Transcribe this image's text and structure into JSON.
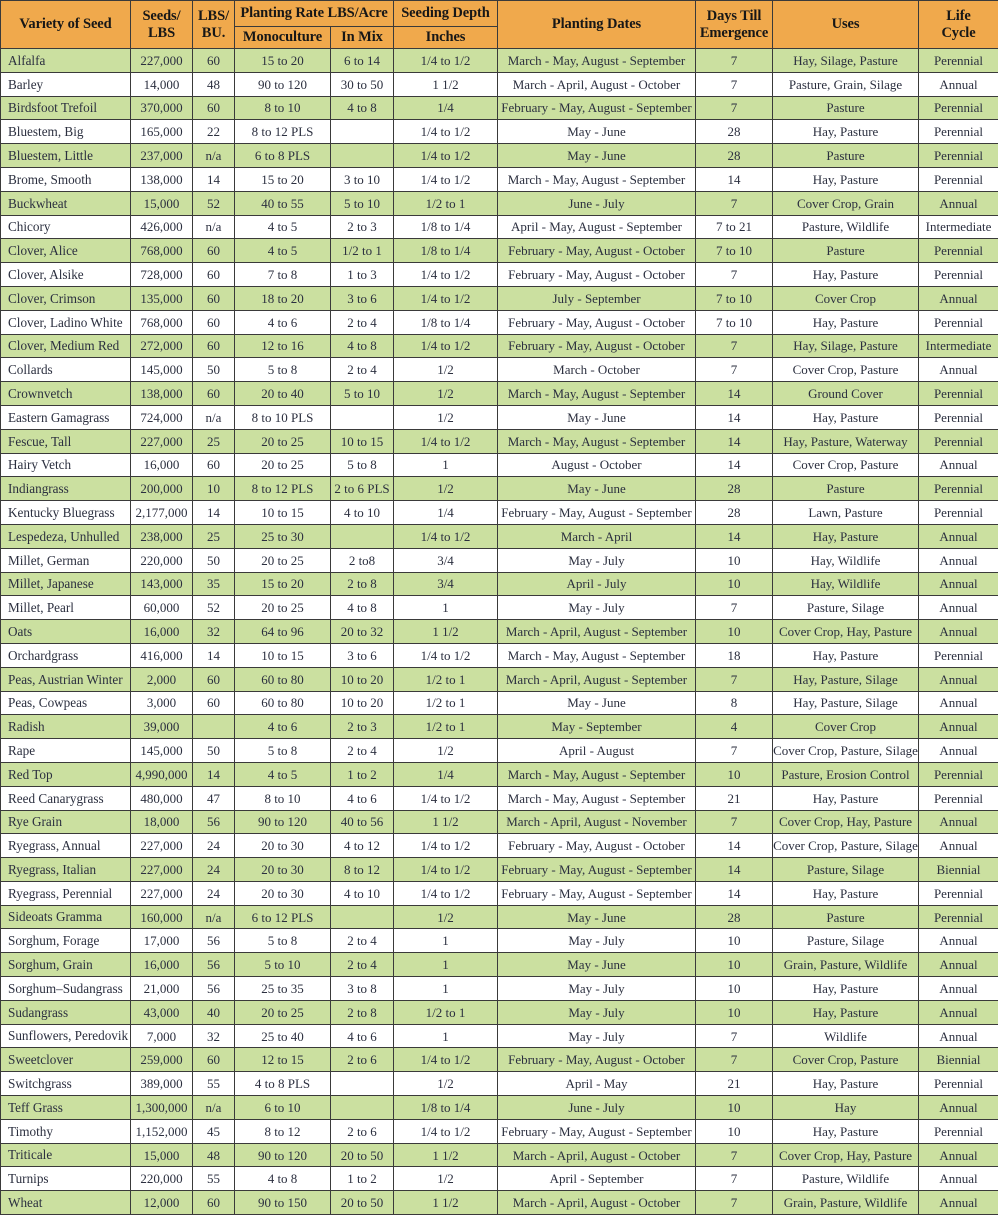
{
  "table": {
    "headers": {
      "variety": "Variety of Seed",
      "seeds_per_lbs_line1": "Seeds/",
      "seeds_per_lbs_line2": "LBS",
      "lbs_per_bu_line1": "LBS/",
      "lbs_per_bu_line2": "BU.",
      "planting_rate_group": "Planting Rate LBS/Acre",
      "monoculture": "Monoculture",
      "in_mix": "In Mix",
      "seeding_depth_group": "Seeding Depth",
      "inches": "Inches",
      "planting_dates": "Planting Dates",
      "days_till_emergence_line1": "Days Till",
      "days_till_emergence_line2": "Emergence",
      "uses": "Uses",
      "life_cycle_line1": "Life",
      "life_cycle_line2": "Cycle"
    },
    "colors": {
      "header_orange": "#f0a94c",
      "row_green": "#cbe0a0",
      "row_white": "#ffffff",
      "border": "#3a3a3a",
      "text": "#2b2f3f"
    },
    "rows": [
      {
        "variety": "Alfalfa",
        "seeds_per_lbs": "227,000",
        "lbs_per_bu": "60",
        "monoculture": "15 to 20",
        "in_mix": "6 to 14",
        "inches": "1/4 to 1/2",
        "planting_dates": "March - May, August - September",
        "days_till_emergence": "7",
        "uses": "Hay, Silage, Pasture",
        "life_cycle": "Perennial",
        "shade": "green"
      },
      {
        "variety": "Barley",
        "seeds_per_lbs": "14,000",
        "lbs_per_bu": "48",
        "monoculture": "90 to 120",
        "in_mix": "30 to 50",
        "inches": "1 1/2",
        "planting_dates": "March - April, August - October",
        "days_till_emergence": "7",
        "uses": "Pasture, Grain, Silage",
        "life_cycle": "Annual",
        "shade": "white"
      },
      {
        "variety": "Birdsfoot Trefoil",
        "seeds_per_lbs": "370,000",
        "lbs_per_bu": "60",
        "monoculture": "8 to 10",
        "in_mix": "4 to 8",
        "inches": "1/4",
        "planting_dates": "February - May, August - September",
        "days_till_emergence": "7",
        "uses": "Pasture",
        "life_cycle": "Perennial",
        "shade": "green"
      },
      {
        "variety": "Bluestem, Big",
        "seeds_per_lbs": "165,000",
        "lbs_per_bu": "22",
        "monoculture": "8 to 12 PLS",
        "in_mix": "",
        "inches": "1/4 to 1/2",
        "planting_dates": "May - June",
        "days_till_emergence": "28",
        "uses": "Hay, Pasture",
        "life_cycle": "Perennial",
        "shade": "white"
      },
      {
        "variety": "Bluestem, Little",
        "seeds_per_lbs": "237,000",
        "lbs_per_bu": "n/a",
        "monoculture": "6 to 8 PLS",
        "in_mix": "",
        "inches": "1/4 to 1/2",
        "planting_dates": "May - June",
        "days_till_emergence": "28",
        "uses": "Pasture",
        "life_cycle": "Perennial",
        "shade": "green"
      },
      {
        "variety": "Brome, Smooth",
        "seeds_per_lbs": "138,000",
        "lbs_per_bu": "14",
        "monoculture": "15 to 20",
        "in_mix": "3 to 10",
        "inches": "1/4 to 1/2",
        "planting_dates": "March - May, August - September",
        "days_till_emergence": "14",
        "uses": "Hay, Pasture",
        "life_cycle": "Perennial",
        "shade": "white"
      },
      {
        "variety": "Buckwheat",
        "seeds_per_lbs": "15,000",
        "lbs_per_bu": "52",
        "monoculture": "40 to 55",
        "in_mix": "5 to 10",
        "inches": "1/2 to 1",
        "planting_dates": "June - July",
        "days_till_emergence": "7",
        "uses": "Cover Crop, Grain",
        "life_cycle": "Annual",
        "shade": "green"
      },
      {
        "variety": "Chicory",
        "seeds_per_lbs": "426,000",
        "lbs_per_bu": "n/a",
        "monoculture": "4 to 5",
        "in_mix": "2 to 3",
        "inches": "1/8 to 1/4",
        "planting_dates": "April - May, August - September",
        "days_till_emergence": "7 to 21",
        "uses": "Pasture, Wildlife",
        "life_cycle": "Intermediate",
        "shade": "white"
      },
      {
        "variety": "Clover, Alice",
        "seeds_per_lbs": "768,000",
        "lbs_per_bu": "60",
        "monoculture": "4 to 5",
        "in_mix": "1/2 to 1",
        "inches": "1/8 to 1/4",
        "planting_dates": "February - May, August - October",
        "days_till_emergence": "7 to 10",
        "uses": "Pasture",
        "life_cycle": "Perennial",
        "shade": "green"
      },
      {
        "variety": "Clover, Alsike",
        "seeds_per_lbs": "728,000",
        "lbs_per_bu": "60",
        "monoculture": "7 to 8",
        "in_mix": "1 to 3",
        "inches": "1/4 to 1/2",
        "planting_dates": "February - May, August - October",
        "days_till_emergence": "7",
        "uses": "Hay, Pasture",
        "life_cycle": "Perennial",
        "shade": "white"
      },
      {
        "variety": "Clover, Crimson",
        "seeds_per_lbs": "135,000",
        "lbs_per_bu": "60",
        "monoculture": "18 to 20",
        "in_mix": "3 to 6",
        "inches": "1/4 to 1/2",
        "planting_dates": "July - September",
        "days_till_emergence": "7 to 10",
        "uses": "Cover Crop",
        "life_cycle": "Annual",
        "shade": "green"
      },
      {
        "variety": "Clover, Ladino White",
        "seeds_per_lbs": "768,000",
        "lbs_per_bu": "60",
        "monoculture": "4 to 6",
        "in_mix": "2 to 4",
        "inches": "1/8 to 1/4",
        "planting_dates": "February - May, August - October",
        "days_till_emergence": "7 to 10",
        "uses": "Hay, Pasture",
        "life_cycle": "Perennial",
        "shade": "white"
      },
      {
        "variety": "Clover, Medium Red",
        "seeds_per_lbs": "272,000",
        "lbs_per_bu": "60",
        "monoculture": "12 to 16",
        "in_mix": "4 to 8",
        "inches": "1/4 to 1/2",
        "planting_dates": "February - May, August - October",
        "days_till_emergence": "7",
        "uses": "Hay, Silage, Pasture",
        "life_cycle": "Intermediate",
        "shade": "green"
      },
      {
        "variety": "Collards",
        "seeds_per_lbs": "145,000",
        "lbs_per_bu": "50",
        "monoculture": "5 to 8",
        "in_mix": "2 to 4",
        "inches": "1/2",
        "planting_dates": "March - October",
        "days_till_emergence": "7",
        "uses": "Cover Crop, Pasture",
        "life_cycle": "Annual",
        "shade": "white"
      },
      {
        "variety": "Crownvetch",
        "seeds_per_lbs": "138,000",
        "lbs_per_bu": "60",
        "monoculture": "20 to 40",
        "in_mix": "5 to 10",
        "inches": "1/2",
        "planting_dates": "March - May, August - September",
        "days_till_emergence": "14",
        "uses": "Ground Cover",
        "life_cycle": "Perennial",
        "shade": "green"
      },
      {
        "variety": "Eastern Gamagrass",
        "seeds_per_lbs": "724,000",
        "lbs_per_bu": "n/a",
        "monoculture": "8 to 10 PLS",
        "in_mix": "",
        "inches": "1/2",
        "planting_dates": "May - June",
        "days_till_emergence": "14",
        "uses": "Hay, Pasture",
        "life_cycle": "Perennial",
        "shade": "white"
      },
      {
        "variety": "Fescue, Tall",
        "seeds_per_lbs": "227,000",
        "lbs_per_bu": "25",
        "monoculture": "20 to 25",
        "in_mix": "10 to 15",
        "inches": "1/4 to 1/2",
        "planting_dates": "March - May, August - September",
        "days_till_emergence": "14",
        "uses": "Hay, Pasture, Waterway",
        "life_cycle": "Perennial",
        "shade": "green"
      },
      {
        "variety": "Hairy Vetch",
        "seeds_per_lbs": "16,000",
        "lbs_per_bu": "60",
        "monoculture": "20 to 25",
        "in_mix": "5 to 8",
        "inches": "1",
        "planting_dates": "August - October",
        "days_till_emergence": "14",
        "uses": "Cover Crop, Pasture",
        "life_cycle": "Annual",
        "shade": "white"
      },
      {
        "variety": "Indiangrass",
        "seeds_per_lbs": "200,000",
        "lbs_per_bu": "10",
        "monoculture": "8 to 12 PLS",
        "in_mix": "2 to 6 PLS",
        "inches": "1/2",
        "planting_dates": "May - June",
        "days_till_emergence": "28",
        "uses": "Pasture",
        "life_cycle": "Perennial",
        "shade": "green"
      },
      {
        "variety": "Kentucky Bluegrass",
        "seeds_per_lbs": "2,177,000",
        "lbs_per_bu": "14",
        "monoculture": "10 to 15",
        "in_mix": "4 to 10",
        "inches": "1/4",
        "planting_dates": "February - May, August - September",
        "days_till_emergence": "28",
        "uses": "Lawn, Pasture",
        "life_cycle": "Perennial",
        "shade": "white"
      },
      {
        "variety": "Lespedeza, Unhulled",
        "seeds_per_lbs": "238,000",
        "lbs_per_bu": "25",
        "monoculture": "25 to 30",
        "in_mix": "",
        "inches": "1/4 to 1/2",
        "planting_dates": "March - April",
        "days_till_emergence": "14",
        "uses": "Hay, Pasture",
        "life_cycle": "Annual",
        "shade": "green"
      },
      {
        "variety": "Millet, German",
        "seeds_per_lbs": "220,000",
        "lbs_per_bu": "50",
        "monoculture": "20 to 25",
        "in_mix": "2 to8",
        "inches": "3/4",
        "planting_dates": "May - July",
        "days_till_emergence": "10",
        "uses": "Hay, Wildlife",
        "life_cycle": "Annual",
        "shade": "white"
      },
      {
        "variety": "Millet, Japanese",
        "seeds_per_lbs": "143,000",
        "lbs_per_bu": "35",
        "monoculture": "15 to 20",
        "in_mix": "2 to 8",
        "inches": "3/4",
        "planting_dates": "April - July",
        "days_till_emergence": "10",
        "uses": "Hay, Wildlife",
        "life_cycle": "Annual",
        "shade": "green"
      },
      {
        "variety": "Millet, Pearl",
        "seeds_per_lbs": "60,000",
        "lbs_per_bu": "52",
        "monoculture": "20 to 25",
        "in_mix": "4 to 8",
        "inches": "1",
        "planting_dates": "May - July",
        "days_till_emergence": "7",
        "uses": "Pasture, Silage",
        "life_cycle": "Annual",
        "shade": "white"
      },
      {
        "variety": "Oats",
        "seeds_per_lbs": "16,000",
        "lbs_per_bu": "32",
        "monoculture": "64 to 96",
        "in_mix": "20 to 32",
        "inches": "1 1/2",
        "planting_dates": "March - April, August - September",
        "days_till_emergence": "10",
        "uses": "Cover Crop, Hay, Pasture",
        "life_cycle": "Annual",
        "shade": "green"
      },
      {
        "variety": "Orchardgrass",
        "seeds_per_lbs": "416,000",
        "lbs_per_bu": "14",
        "monoculture": "10 to 15",
        "in_mix": "3 to 6",
        "inches": "1/4 to 1/2",
        "planting_dates": "March - May, August - September",
        "days_till_emergence": "18",
        "uses": "Hay, Pasture",
        "life_cycle": "Perennial",
        "shade": "white"
      },
      {
        "variety": "Peas, Austrian Winter",
        "seeds_per_lbs": "2,000",
        "lbs_per_bu": "60",
        "monoculture": "60 to 80",
        "in_mix": "10 to 20",
        "inches": "1/2 to 1",
        "planting_dates": "March - April, August - September",
        "days_till_emergence": "7",
        "uses": "Hay, Pasture, Silage",
        "life_cycle": "Annual",
        "shade": "green"
      },
      {
        "variety": "Peas, Cowpeas",
        "seeds_per_lbs": "3,000",
        "lbs_per_bu": "60",
        "monoculture": "60 to 80",
        "in_mix": "10 to 20",
        "inches": "1/2 to 1",
        "planting_dates": "May - June",
        "days_till_emergence": "8",
        "uses": "Hay, Pasture, Silage",
        "life_cycle": "Annual",
        "shade": "white"
      },
      {
        "variety": "Radish",
        "seeds_per_lbs": "39,000",
        "lbs_per_bu": "",
        "monoculture": "4 to 6",
        "in_mix": "2 to 3",
        "inches": "1/2 to 1",
        "planting_dates": "May - September",
        "days_till_emergence": "4",
        "uses": "Cover Crop",
        "life_cycle": "Annual",
        "shade": "green"
      },
      {
        "variety": "Rape",
        "seeds_per_lbs": "145,000",
        "lbs_per_bu": "50",
        "monoculture": "5 to 8",
        "in_mix": "2 to 4",
        "inches": "1/2",
        "planting_dates": "April - August",
        "days_till_emergence": "7",
        "uses": "Cover Crop, Pasture, Silage",
        "life_cycle": "Annual",
        "shade": "white"
      },
      {
        "variety": "Red Top",
        "seeds_per_lbs": "4,990,000",
        "lbs_per_bu": "14",
        "monoculture": "4 to 5",
        "in_mix": "1 to 2",
        "inches": "1/4",
        "planting_dates": "March - May, August - September",
        "days_till_emergence": "10",
        "uses": "Pasture, Erosion Control",
        "life_cycle": "Perennial",
        "shade": "green"
      },
      {
        "variety": "Reed Canarygrass",
        "seeds_per_lbs": "480,000",
        "lbs_per_bu": "47",
        "monoculture": "8 to 10",
        "in_mix": "4 to 6",
        "inches": "1/4 to 1/2",
        "planting_dates": "March - May, August - September",
        "days_till_emergence": "21",
        "uses": "Hay, Pasture",
        "life_cycle": "Perennial",
        "shade": "white"
      },
      {
        "variety": "Rye Grain",
        "seeds_per_lbs": "18,000",
        "lbs_per_bu": "56",
        "monoculture": "90 to 120",
        "in_mix": "40 to 56",
        "inches": "1 1/2",
        "planting_dates": "March - April, August - November",
        "days_till_emergence": "7",
        "uses": "Cover Crop, Hay, Pasture",
        "life_cycle": "Annual",
        "shade": "green"
      },
      {
        "variety": "Ryegrass, Annual",
        "seeds_per_lbs": "227,000",
        "lbs_per_bu": "24",
        "monoculture": "20 to 30",
        "in_mix": "4 to 12",
        "inches": "1/4 to 1/2",
        "planting_dates": "February - May, August - October",
        "days_till_emergence": "14",
        "uses": "Cover Crop, Pasture, Silage",
        "life_cycle": "Annual",
        "shade": "white"
      },
      {
        "variety": "Ryegrass, Italian",
        "seeds_per_lbs": "227,000",
        "lbs_per_bu": "24",
        "monoculture": "20 to 30",
        "in_mix": "8 to 12",
        "inches": "1/4 to 1/2",
        "planting_dates": "February - May, August - September",
        "days_till_emergence": "14",
        "uses": "Pasture, Silage",
        "life_cycle": "Biennial",
        "shade": "green"
      },
      {
        "variety": "Ryegrass, Perennial",
        "seeds_per_lbs": "227,000",
        "lbs_per_bu": "24",
        "monoculture": "20 to 30",
        "in_mix": "4 to 10",
        "inches": "1/4 to 1/2",
        "planting_dates": "February - May, August - September",
        "days_till_emergence": "14",
        "uses": "Hay, Pasture",
        "life_cycle": "Perennial",
        "shade": "white"
      },
      {
        "variety": "Sideoats Gramma",
        "seeds_per_lbs": "160,000",
        "lbs_per_bu": "n/a",
        "monoculture": "6 to 12 PLS",
        "in_mix": "",
        "inches": "1/2",
        "planting_dates": "May - June",
        "days_till_emergence": "28",
        "uses": "Pasture",
        "life_cycle": "Perennial",
        "shade": "green"
      },
      {
        "variety": "Sorghum, Forage",
        "seeds_per_lbs": "17,000",
        "lbs_per_bu": "56",
        "monoculture": "5 to 8",
        "in_mix": "2 to 4",
        "inches": "1",
        "planting_dates": "May - July",
        "days_till_emergence": "10",
        "uses": "Pasture, Silage",
        "life_cycle": "Annual",
        "shade": "white"
      },
      {
        "variety": "Sorghum, Grain",
        "seeds_per_lbs": "16,000",
        "lbs_per_bu": "56",
        "monoculture": "5 to 10",
        "in_mix": "2 to 4",
        "inches": "1",
        "planting_dates": "May - June",
        "days_till_emergence": "10",
        "uses": "Grain, Pasture, Wildlife",
        "life_cycle": "Annual",
        "shade": "green"
      },
      {
        "variety": "Sorghum–Sudangrass",
        "seeds_per_lbs": "21,000",
        "lbs_per_bu": "56",
        "monoculture": "25 to 35",
        "in_mix": "3 to 8",
        "inches": "1",
        "planting_dates": "May - July",
        "days_till_emergence": "10",
        "uses": "Hay, Pasture",
        "life_cycle": "Annual",
        "shade": "white"
      },
      {
        "variety": "Sudangrass",
        "seeds_per_lbs": "43,000",
        "lbs_per_bu": "40",
        "monoculture": "20 to 25",
        "in_mix": "2 to 8",
        "inches": "1/2 to 1",
        "planting_dates": "May - July",
        "days_till_emergence": "10",
        "uses": "Hay, Pasture",
        "life_cycle": "Annual",
        "shade": "green"
      },
      {
        "variety": "Sunflowers, Peredovik",
        "seeds_per_lbs": "7,000",
        "lbs_per_bu": "32",
        "monoculture": "25 to 40",
        "in_mix": "4 to 6",
        "inches": "1",
        "planting_dates": "May - July",
        "days_till_emergence": "7",
        "uses": "Wildlife",
        "life_cycle": "Annual",
        "shade": "white"
      },
      {
        "variety": "Sweetclover",
        "seeds_per_lbs": "259,000",
        "lbs_per_bu": "60",
        "monoculture": "12 to 15",
        "in_mix": "2 to 6",
        "inches": "1/4 to 1/2",
        "planting_dates": "February - May, August - October",
        "days_till_emergence": "7",
        "uses": "Cover Crop, Pasture",
        "life_cycle": "Biennial",
        "shade": "green"
      },
      {
        "variety": "Switchgrass",
        "seeds_per_lbs": "389,000",
        "lbs_per_bu": "55",
        "monoculture": "4 to 8 PLS",
        "in_mix": "",
        "inches": "1/2",
        "planting_dates": "April - May",
        "days_till_emergence": "21",
        "uses": "Hay, Pasture",
        "life_cycle": "Perennial",
        "shade": "white"
      },
      {
        "variety": "Teff Grass",
        "seeds_per_lbs": "1,300,000",
        "lbs_per_bu": "n/a",
        "monoculture": "6 to 10",
        "in_mix": "",
        "inches": "1/8 to 1/4",
        "planting_dates": "June - July",
        "days_till_emergence": "10",
        "uses": "Hay",
        "life_cycle": "Annual",
        "shade": "green"
      },
      {
        "variety": "Timothy",
        "seeds_per_lbs": "1,152,000",
        "lbs_per_bu": "45",
        "monoculture": "8 to 12",
        "in_mix": "2 to 6",
        "inches": "1/4 to 1/2",
        "planting_dates": "February - May, August - September",
        "days_till_emergence": "10",
        "uses": "Hay, Pasture",
        "life_cycle": "Perennial",
        "shade": "white"
      },
      {
        "variety": "Triticale",
        "seeds_per_lbs": "15,000",
        "lbs_per_bu": "48",
        "monoculture": "90 to 120",
        "in_mix": "20 to 50",
        "inches": "1 1/2",
        "planting_dates": "March - April, August - October",
        "days_till_emergence": "7",
        "uses": "Cover Crop, Hay, Pasture",
        "life_cycle": "Annual",
        "shade": "green"
      },
      {
        "variety": "Turnips",
        "seeds_per_lbs": "220,000",
        "lbs_per_bu": "55",
        "monoculture": "4 to 8",
        "in_mix": "1 to 2",
        "inches": "1/2",
        "planting_dates": "April - September",
        "days_till_emergence": "7",
        "uses": "Pasture, Wildlife",
        "life_cycle": "Annual",
        "shade": "white"
      },
      {
        "variety": "Wheat",
        "seeds_per_lbs": "12,000",
        "lbs_per_bu": "60",
        "monoculture": "90 to 150",
        "in_mix": "20 to 50",
        "inches": "1 1/2",
        "planting_dates": "March - April, August - October",
        "days_till_emergence": "7",
        "uses": "Grain, Pasture, Wildlife",
        "life_cycle": "Annual",
        "shade": "green"
      }
    ]
  }
}
